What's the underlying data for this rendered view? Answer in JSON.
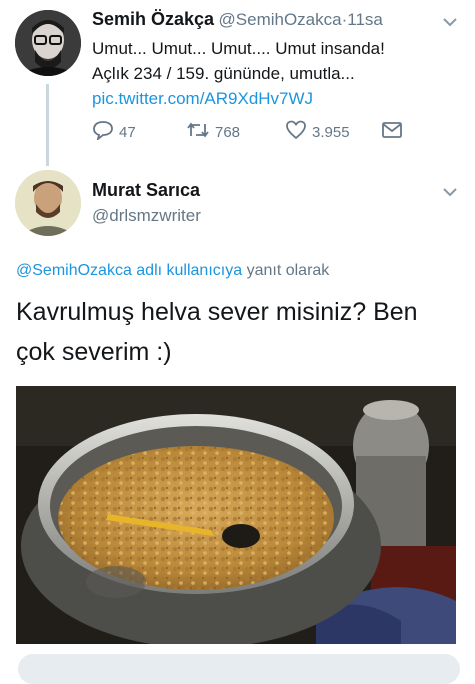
{
  "tweet1": {
    "name": "Semih Özakça",
    "handle": "@SemihOzakca",
    "dot": "·",
    "time": "11sa",
    "line1": "Umut... Umut... Umut.... Umut insanda!",
    "line2": "Açlık 234 / 159. gününde, umutla...",
    "link": "pic.twitter.com/AR9XdHv7WJ",
    "reply_count": "47",
    "retweet_count": "768",
    "like_count": "3.955"
  },
  "tweet2": {
    "name": "Murat Sarıca",
    "handle": "@drlsmzwriter",
    "reply_to_user": "@SemihOzakca adlı kullanıcıya",
    "reply_to_suffix": "yanıt olarak",
    "line1": "Kavrulmuş helva sever misiniz? Ben",
    "line2": "çok severim :)"
  },
  "icons": {
    "reply": "reply-icon",
    "retweet": "retweet-icon",
    "like": "heart-icon",
    "dm": "envelope-icon",
    "menu": "chevron-down-icon"
  },
  "colors": {
    "link": "#1b95e0",
    "secondary": "#657786",
    "thread_line": "#ccd6dd"
  }
}
